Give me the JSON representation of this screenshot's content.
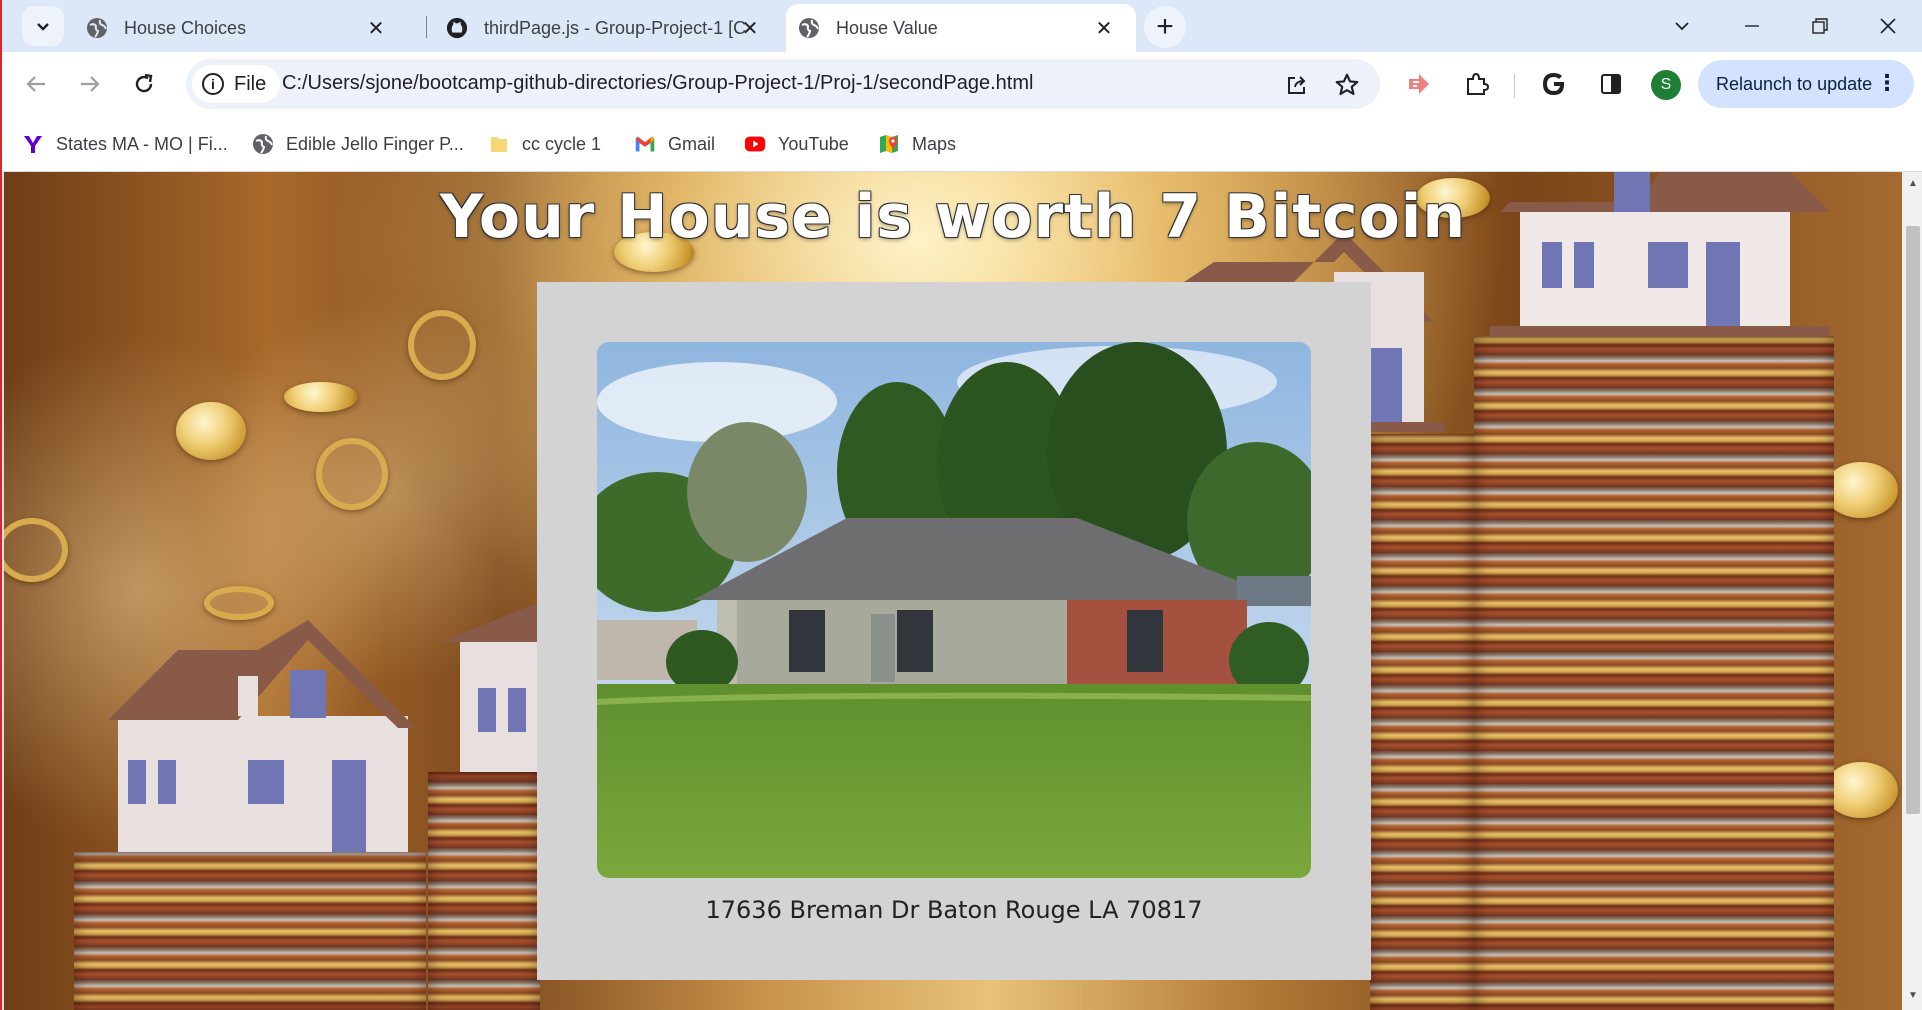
{
  "browser": {
    "tabs": [
      {
        "title": "House Choices",
        "favicon": "globe-icon",
        "active": false
      },
      {
        "title": "thirdPage.js - Group-Project-1 [C",
        "favicon": "github-icon",
        "active": false
      },
      {
        "title": "House Value",
        "favicon": "globe-icon",
        "active": true
      }
    ],
    "address": {
      "chip_label": "File",
      "url": "C:/Users/sjone/bootcamp-github-directories/Group-Project-1/Proj-1/secondPage.html"
    },
    "profile_initial": "S",
    "relaunch_label": "Relaunch to update",
    "bookmarks": [
      {
        "label": "States MA - MO | Fi...",
        "icon": "yahoo-icon"
      },
      {
        "label": "Edible Jello Finger P...",
        "icon": "globe-icon"
      },
      {
        "label": "cc cycle 1",
        "icon": "folder-icon"
      },
      {
        "label": "Gmail",
        "icon": "gmail-icon"
      },
      {
        "label": "YouTube",
        "icon": "youtube-icon"
      },
      {
        "label": "Maps",
        "icon": "maps-icon"
      }
    ]
  },
  "page": {
    "heading": "Your House is worth 7 Bitcoin",
    "address": "17636 Breman Dr Baton Rouge LA 70817"
  }
}
